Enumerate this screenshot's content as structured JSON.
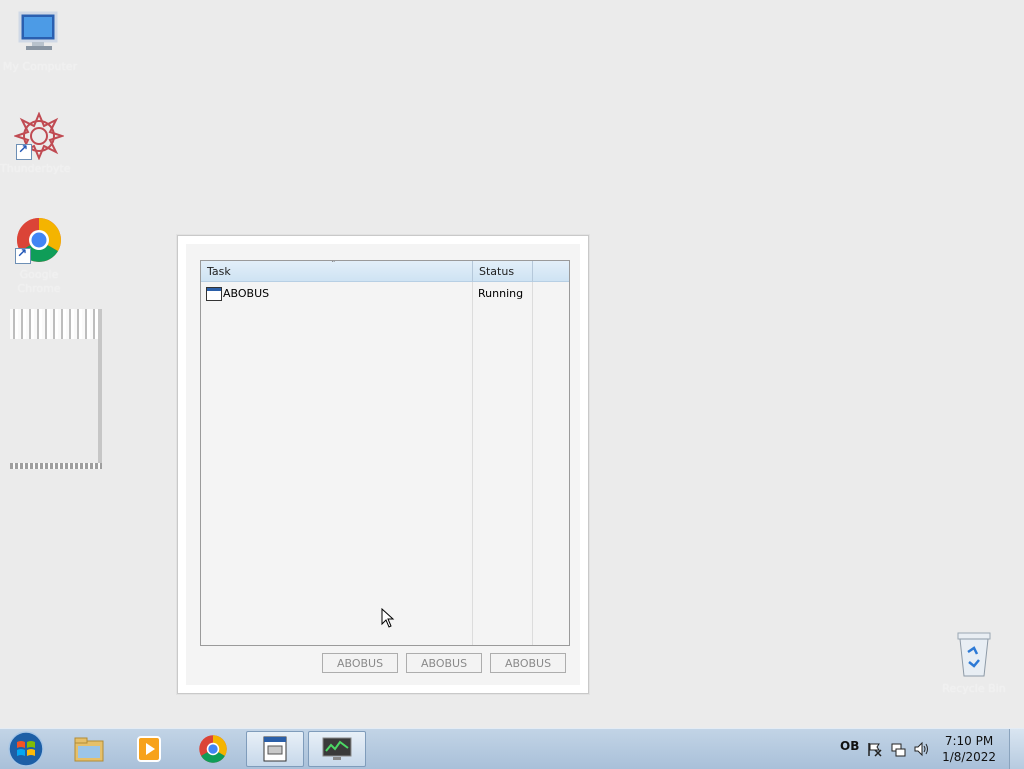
{
  "desktop": {
    "icons": [
      {
        "name": "My Computer",
        "icon": "computer-icon"
      },
      {
        "name": "Thunderbyte",
        "icon": "flower-icon"
      },
      {
        "name": "Google Chrome",
        "icon": "chrome-icon"
      },
      {
        "name": "Recycle Bin",
        "icon": "recycle-bin-icon"
      }
    ]
  },
  "window": {
    "columns": {
      "task": "Task",
      "status": "Status"
    },
    "rows": [
      {
        "task": "ABOBUS",
        "status": "Running"
      }
    ],
    "buttons": [
      "ABOBUS",
      "ABOBUS",
      "ABOBUS"
    ]
  },
  "taskbar": {
    "pinned": [
      "start-orb-icon",
      "file-explorer-icon",
      "media-player-icon",
      "chrome-icon",
      "task-window-icon",
      "monitor-app-icon"
    ],
    "language": "ОВ",
    "clock": {
      "time": "7:10 PM",
      "date": "1/8/2022"
    }
  },
  "colors": {
    "taskbar": "#a9c0d9",
    "desktop": "#ebebeb",
    "header": "#d8e8f6"
  }
}
